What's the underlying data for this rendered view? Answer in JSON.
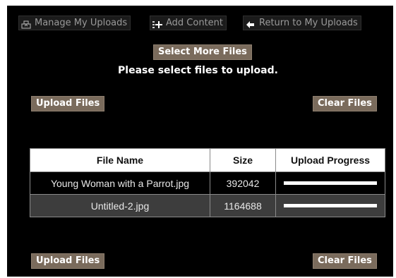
{
  "toolbar": {
    "manage_label": "Manage My Uploads",
    "manage_icon": "manage-uploads-icon",
    "add_label": "Add Content",
    "add_icon": "add-content-icon",
    "return_label": "Return to My Uploads",
    "return_icon": "arrow-left-icon"
  },
  "select_more_label": "Select More Files",
  "instruction": "Please select files to upload.",
  "upload_files_label": "Upload Files",
  "clear_files_label": "Clear Files",
  "table": {
    "headers": [
      "File Name",
      "Size",
      "Upload Progress"
    ],
    "rows": [
      {
        "name": "Young Woman with a Parrot.jpg",
        "size": "392042",
        "progress": 1.0
      },
      {
        "name": "Untitled-2.jpg",
        "size": "1164688",
        "progress": 1.0
      }
    ]
  },
  "colors": {
    "panel_bg": "#000000",
    "button_bg": "#7a6b5c",
    "header_bg": "#ffffff",
    "alt_row_bg": "#3d3d3d"
  }
}
